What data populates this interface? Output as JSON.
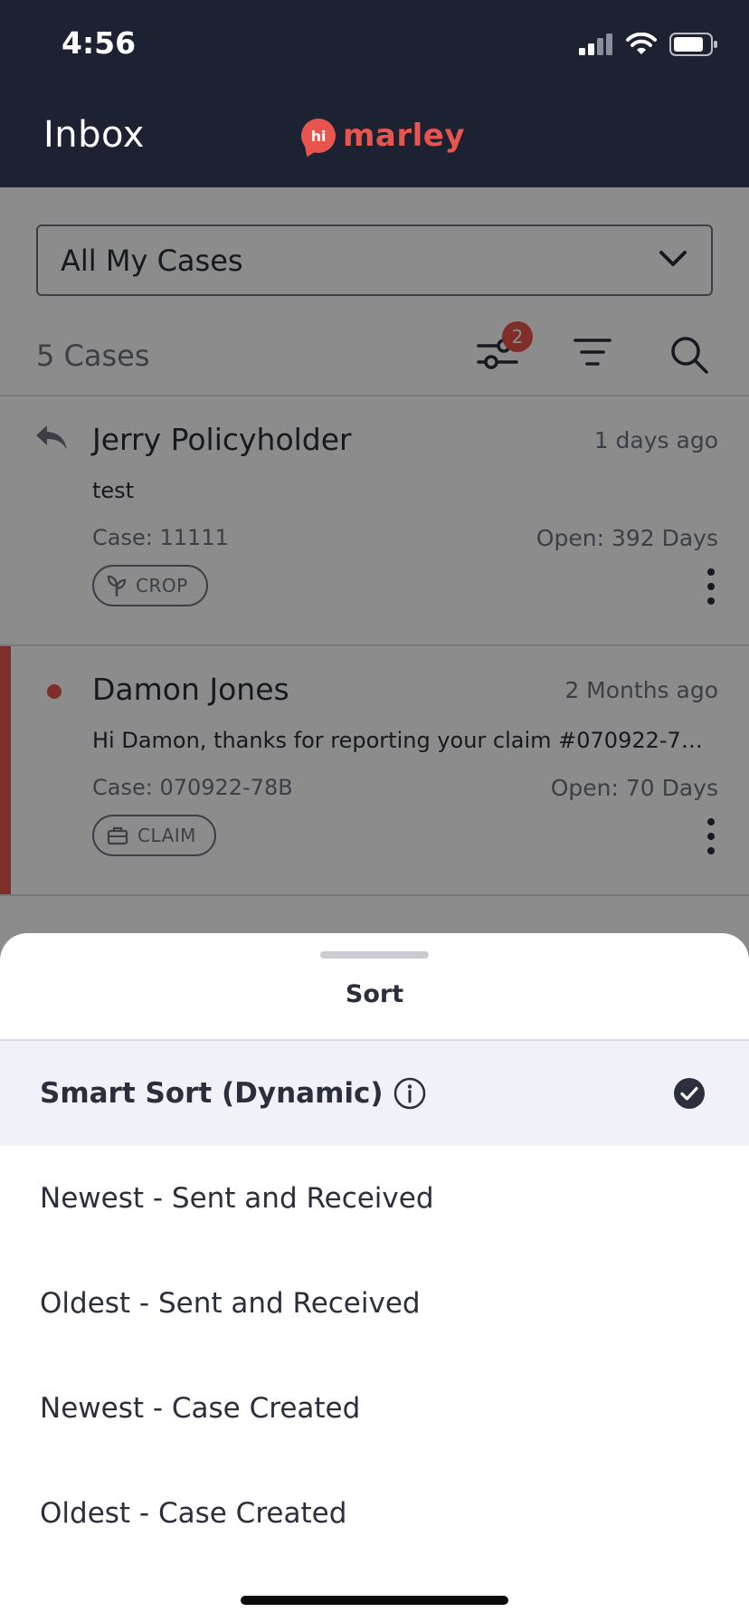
{
  "status_bar": {
    "time": "4:56"
  },
  "header": {
    "title": "Inbox",
    "logo_mark": "hi",
    "logo_word": "marley"
  },
  "case_filter": {
    "selected": "All My Cases"
  },
  "toolbar": {
    "cases_count": "5 Cases",
    "filter_badge": "2"
  },
  "cases": [
    {
      "name": "Jerry Policyholder",
      "ago": "1 days ago",
      "message": "test",
      "case_label": "Case: 11111",
      "open_label": "Open: 392 Days",
      "tag": "CROP",
      "tag_icon": "sprout-icon",
      "indicator": "reply-icon"
    },
    {
      "name": "Damon Jones",
      "ago": "2 Months ago",
      "message": "Hi Damon, thanks for reporting your claim #070922-78B....",
      "case_label": "Case: 070922-78B",
      "open_label": "Open: 70 Days",
      "tag": "CLAIM",
      "tag_icon": "briefcase-icon",
      "indicator": "unread-dot"
    }
  ],
  "sort_sheet": {
    "title": "Sort",
    "options": [
      {
        "label": "Smart Sort (Dynamic)",
        "selected": true
      },
      {
        "label": "Newest - Sent and Received",
        "selected": false
      },
      {
        "label": "Oldest - Sent and Received",
        "selected": false
      },
      {
        "label": "Newest - Case Created",
        "selected": false
      },
      {
        "label": "Oldest - Case Created",
        "selected": false
      }
    ]
  },
  "colors": {
    "header_bg": "#1d2233",
    "brand_red": "#e8554e",
    "text_dark": "#2b2f3d",
    "text_muted": "#6f7382",
    "selected_row_bg": "#f1f2f7"
  }
}
